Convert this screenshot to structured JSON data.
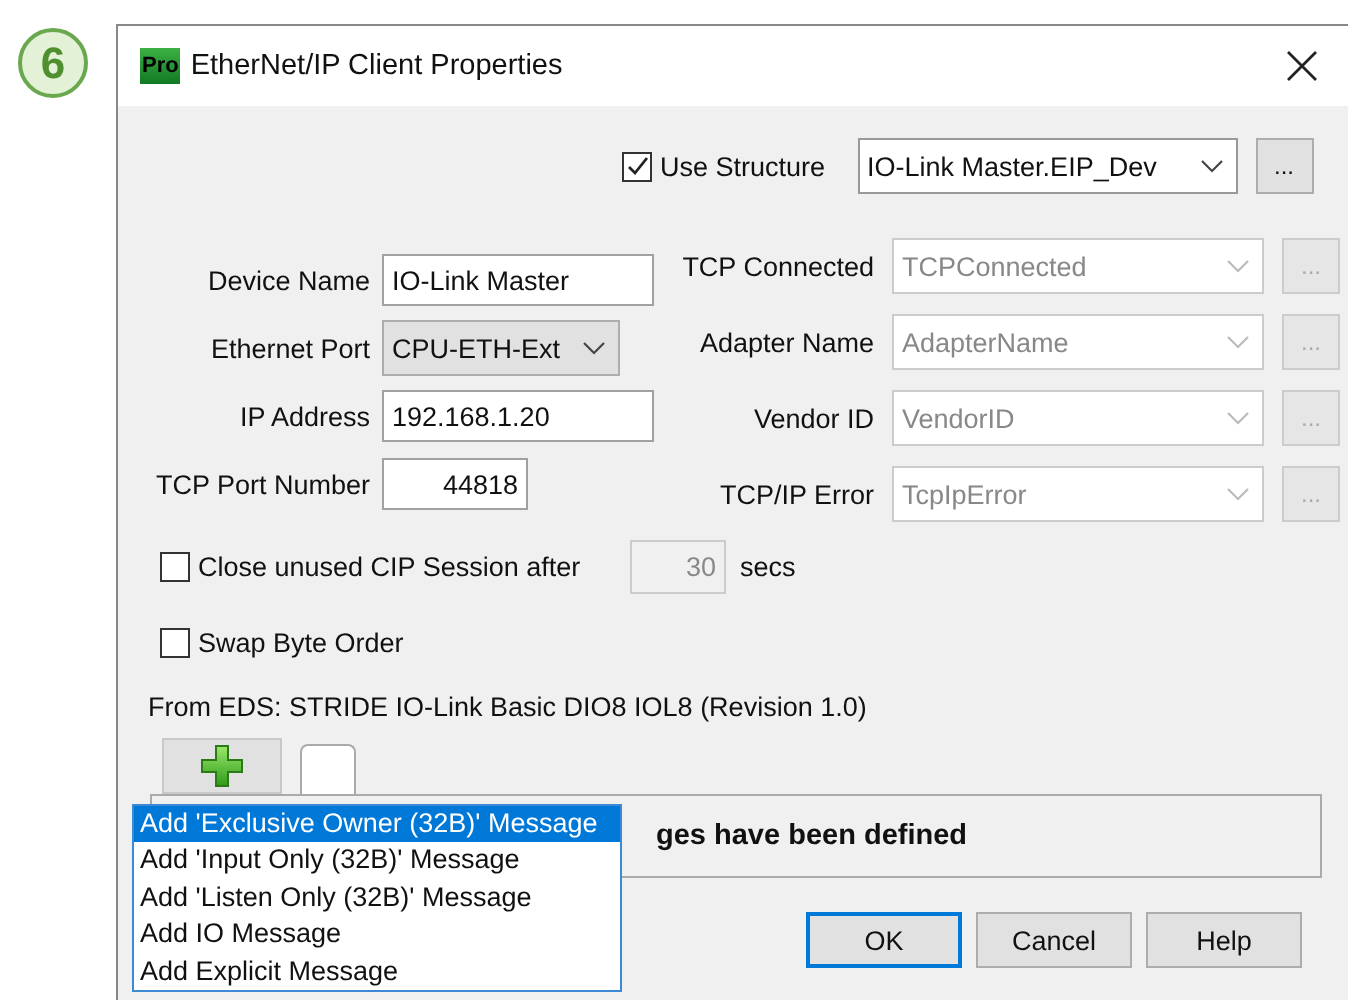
{
  "step_badge": "6",
  "window": {
    "title": "EtherNet/IP Client Properties",
    "app_icon_text": "Pro"
  },
  "use_structure": {
    "label": "Use Structure",
    "checked": true,
    "value": "IO-Link Master.EIP_Dev",
    "browse": "..."
  },
  "left_fields": [
    {
      "label": "Device Name",
      "kind": "text",
      "value": "IO-Link Master"
    },
    {
      "label": "Ethernet Port",
      "kind": "dropdown",
      "value": "CPU-ETH-Ext"
    },
    {
      "label": "IP Address",
      "kind": "text",
      "value": "192.168.1.20"
    },
    {
      "label": "TCP Port Number",
      "kind": "number",
      "value": "44818"
    }
  ],
  "right_fields": [
    {
      "label": "TCP Connected",
      "value": "TCPConnected",
      "disabled": true,
      "browse": "..."
    },
    {
      "label": "Adapter Name",
      "value": "AdapterName",
      "disabled": true,
      "browse": "..."
    },
    {
      "label": "Vendor ID",
      "value": "VendorID",
      "disabled": true,
      "browse": "..."
    },
    {
      "label": "TCP/IP Error",
      "value": "TcpIpError",
      "disabled": true,
      "browse": "..."
    }
  ],
  "close_session": {
    "label": "Close unused CIP Session after",
    "checked": false,
    "value": "30",
    "disabled": true,
    "unit": "secs"
  },
  "swap_byte_order": {
    "label": "Swap Byte Order",
    "checked": false
  },
  "eds_info": "From EDS: STRIDE IO-Link Basic DIO8 IOL8 (Revision 1.0)",
  "messages_panel": {
    "text": "ges have been defined"
  },
  "add_menu": [
    {
      "label": "Add 'Exclusive Owner (32B)' Message",
      "selected": true
    },
    {
      "label": "Add 'Input Only (32B)' Message",
      "selected": false
    },
    {
      "label": "Add 'Listen Only (32B)' Message",
      "selected": false
    },
    {
      "label": "Add IO Message",
      "selected": false
    },
    {
      "label": "Add Explicit Message",
      "selected": false
    }
  ],
  "buttons": [
    {
      "label": "OK",
      "default": true
    },
    {
      "label": "Cancel",
      "default": false
    },
    {
      "label": "Help",
      "default": false
    }
  ]
}
